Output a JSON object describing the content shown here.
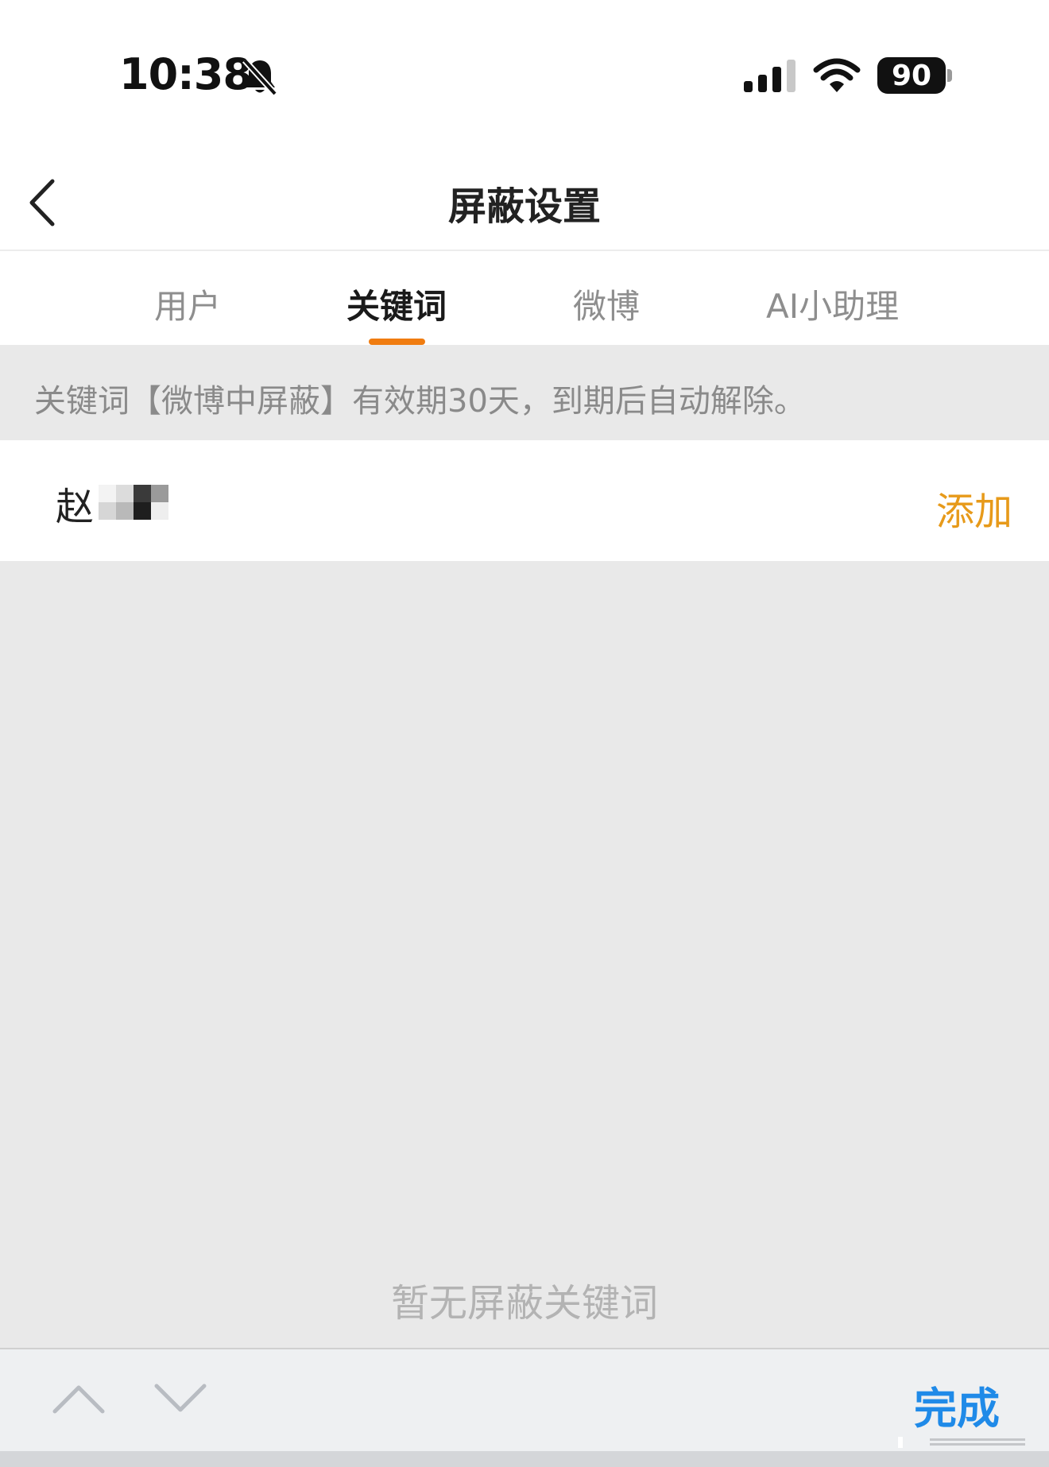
{
  "status_bar": {
    "time": "10:38",
    "mute_icon": "bell-slash-icon",
    "signal_icon": "cellular-signal-icon",
    "wifi_icon": "wifi-icon",
    "battery": "90"
  },
  "nav": {
    "back_icon": "chevron-left-icon",
    "title": "屏蔽设置"
  },
  "tabs": [
    {
      "label": "用户",
      "active": false
    },
    {
      "label": "关键词",
      "active": true
    },
    {
      "label": "微博",
      "active": false
    },
    {
      "label": "AI小助理",
      "active": false
    }
  ],
  "notice": "关键词【微博中屏蔽】有效期30天，到期后自动解除。",
  "keyword_input": {
    "value": "赵",
    "add_label": "添加"
  },
  "empty_state": "暂无屏蔽关键词",
  "keyboard_toolbar": {
    "prev_icon": "chevron-up-icon",
    "next_icon": "chevron-down-icon",
    "done_label": "完成"
  },
  "colors": {
    "accent_orange": "#f07c10",
    "add_orange": "#e79a1a",
    "done_blue": "#1f8ae8",
    "background_gray": "#e9e9e9"
  }
}
